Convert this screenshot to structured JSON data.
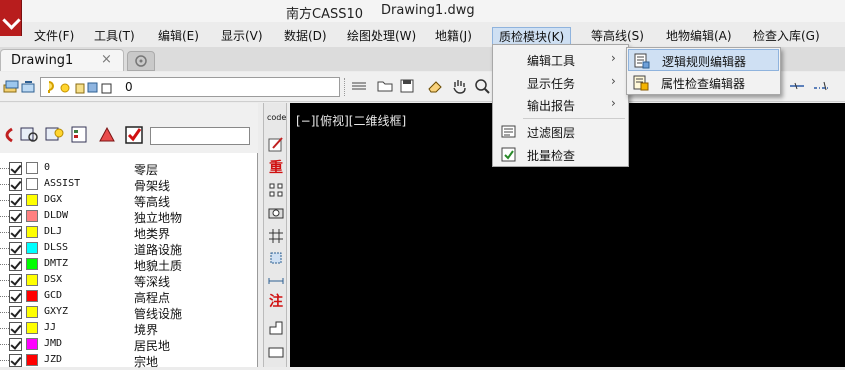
{
  "window": {
    "app_title": "南方CASS10",
    "document_title": "Drawing1.dwg"
  },
  "menubar": {
    "items": [
      {
        "label": "文件(F)"
      },
      {
        "label": "工具(T)"
      },
      {
        "label": "编辑(E)"
      },
      {
        "label": "显示(V)"
      },
      {
        "label": "数据(D)"
      },
      {
        "label": "绘图处理(W)"
      },
      {
        "label": "地籍(J)"
      },
      {
        "label": "质检模块(K)"
      },
      {
        "label": "等高线(S)"
      },
      {
        "label": "地物编辑(A)"
      },
      {
        "label": "检查入库(G)"
      }
    ],
    "active_index": 7
  },
  "tabs": {
    "drawing_tab": "Drawing1",
    "close_symbol": "×"
  },
  "toolbar": {
    "layer_value": "0"
  },
  "layer_panel": {
    "rows": [
      {
        "name": "0",
        "desc": "零层",
        "color": "#ffffff"
      },
      {
        "name": "ASSIST",
        "desc": "骨架线",
        "color": "#ffffff"
      },
      {
        "name": "DGX",
        "desc": "等高线",
        "color": "#ffff00"
      },
      {
        "name": "DLDW",
        "desc": "独立地物",
        "color": "#ff8080"
      },
      {
        "name": "DLJ",
        "desc": "地类界",
        "color": "#ffff00"
      },
      {
        "name": "DLSS",
        "desc": "道路设施",
        "color": "#00ffff"
      },
      {
        "name": "DMTZ",
        "desc": "地貌土质",
        "color": "#00ff00"
      },
      {
        "name": "DSX",
        "desc": "等深线",
        "color": "#ffff00"
      },
      {
        "name": "GCD",
        "desc": "高程点",
        "color": "#ff0000"
      },
      {
        "name": "GXYZ",
        "desc": "管线设施",
        "color": "#ffff00"
      },
      {
        "name": "JJ",
        "desc": "境界",
        "color": "#ffff00"
      },
      {
        "name": "JMD",
        "desc": "居民地",
        "color": "#ff00ff"
      },
      {
        "name": "JZD",
        "desc": "宗地",
        "color": "#ff0000"
      }
    ]
  },
  "side_tools": {
    "code_label": "code",
    "zhong_label": "重",
    "zhu_label": "注"
  },
  "canvas": {
    "view_label": "[−][俯视][二维线框]"
  },
  "dropdown": {
    "items": [
      {
        "label": "编辑工具",
        "has_submenu": true,
        "icon": ""
      },
      {
        "label": "显示任务",
        "has_submenu": true,
        "icon": ""
      },
      {
        "label": "输出报告",
        "has_submenu": true,
        "icon": ""
      },
      {
        "label": "过滤图层",
        "has_submenu": false,
        "icon": "filter-layer-icon"
      },
      {
        "label": "批量检查",
        "has_submenu": false,
        "icon": "batch-check-icon"
      }
    ],
    "arrow": "›"
  },
  "submenu": {
    "items": [
      {
        "label": "逻辑规则编辑器",
        "icon": "rule-editor-icon"
      },
      {
        "label": "属性检查编辑器",
        "icon": "attribute-editor-icon"
      }
    ]
  },
  "colors": {
    "canvas_bg": "#000000",
    "menu_highlight": "#cfe0f3",
    "logo_red": "#b81d1d"
  }
}
